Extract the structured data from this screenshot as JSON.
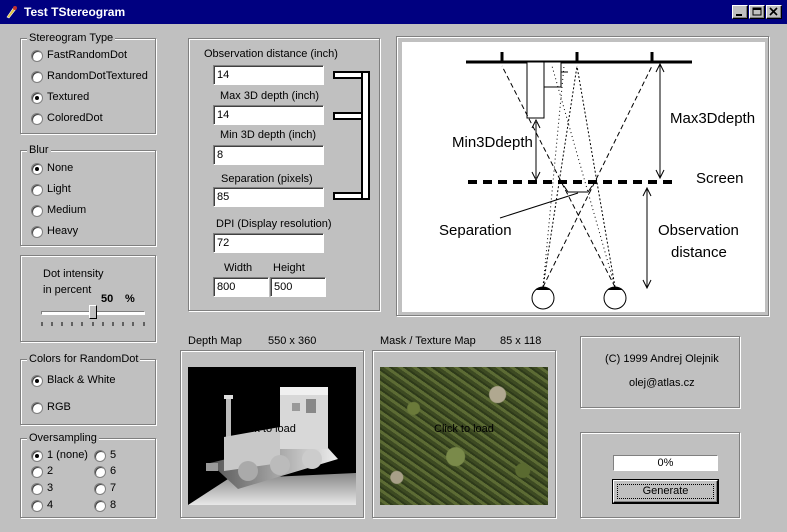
{
  "window": {
    "title": "Test TStereogram"
  },
  "stereogram_type": {
    "legend": "Stereogram Type",
    "options": [
      "FastRandomDot",
      "RandomDotTextured",
      "Textured",
      "ColoredDot"
    ],
    "selected": "Textured"
  },
  "blur": {
    "legend": "Blur",
    "options": [
      "None",
      "Light",
      "Medium",
      "Heavy"
    ],
    "selected": "None"
  },
  "dot_intensity": {
    "label_line1": "Dot intensity",
    "label_line2": "in percent",
    "value": "50",
    "unit": "%",
    "slider_fraction": 0.5
  },
  "colors": {
    "legend": "Colors for RandomDot",
    "options": [
      "Black & White",
      "RGB"
    ],
    "selected": "Black & White"
  },
  "oversampling": {
    "legend": "Oversampling",
    "options": [
      "1 (none)",
      "2",
      "3",
      "4",
      "5",
      "6",
      "7",
      "8"
    ],
    "selected": "1 (none)"
  },
  "params": {
    "observation_label": "Observation distance (inch)",
    "observation_value": "14",
    "max3d_label": "Max 3D depth (inch)",
    "max3d_value": "14",
    "min3d_label": "Min 3D depth (inch)",
    "min3d_value": "8",
    "separation_label": "Separation (pixels)",
    "separation_value": "85",
    "dpi_label": "DPI (Display resolution)",
    "dpi_value": "72",
    "width_label": "Width",
    "width_value": "800",
    "height_label": "Height",
    "height_value": "500"
  },
  "diagram": {
    "min3d": "Min3Ddepth",
    "max3d": "Max3Ddepth",
    "screen": "Screen",
    "separation": "Separation",
    "observation_line1": "Observation",
    "observation_line2": "distance"
  },
  "depth_map": {
    "title": "Depth Map",
    "size": "550 x 360",
    "hint": "Click to load"
  },
  "mask_map": {
    "title": "Mask / Texture Map",
    "size": "85 x 118",
    "hint": "Click to load"
  },
  "about": {
    "copyright": "(C) 1999    Andrej Olejnik",
    "email": "olej@atlas.cz"
  },
  "progress": {
    "text": "0%",
    "fraction": 0
  },
  "generate_label": "Generate"
}
